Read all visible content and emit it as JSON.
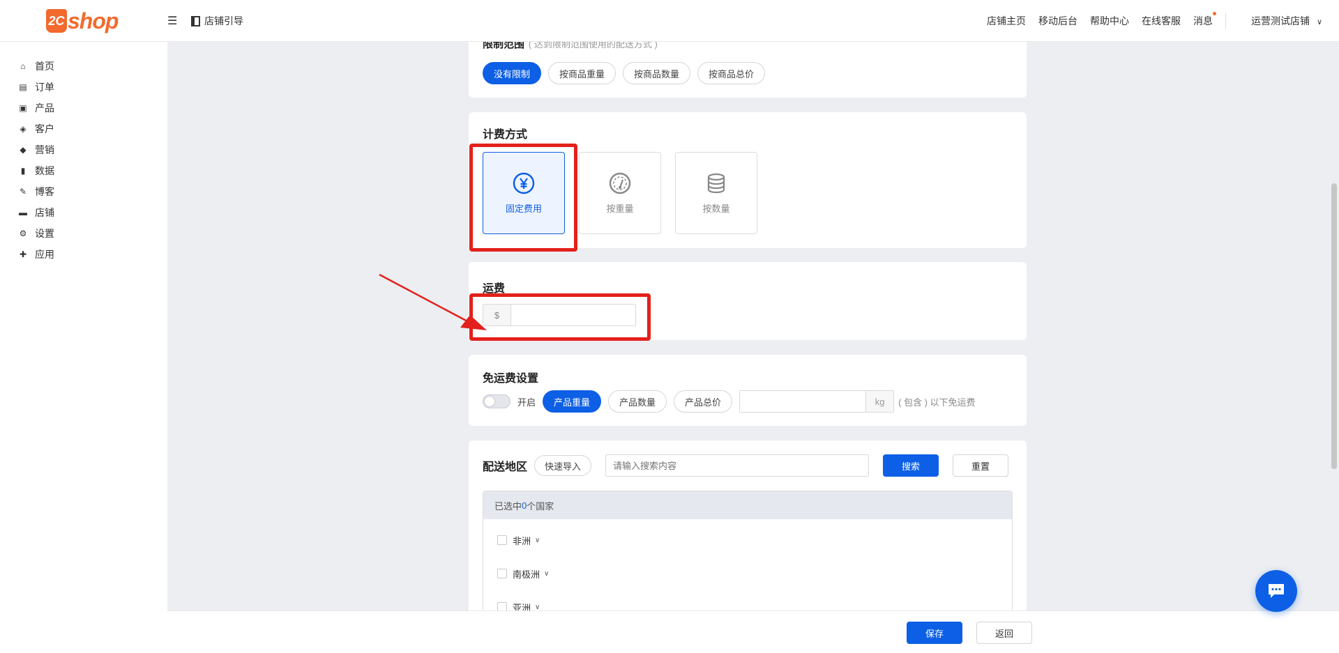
{
  "brand": {
    "logo_mark": "2C",
    "logo_text": "shop"
  },
  "header": {
    "menu_toggle_icon": "menu-icon",
    "guide_label": "店铺引导",
    "nav": [
      "店铺主页",
      "移动后台",
      "帮助中心",
      "在线客服",
      "消息"
    ],
    "store_name": "运营测试店铺"
  },
  "sidebar": {
    "items": [
      {
        "icon": "home-icon",
        "label": "首页"
      },
      {
        "icon": "order-icon",
        "label": "订单"
      },
      {
        "icon": "bag-icon",
        "label": "产品"
      },
      {
        "icon": "diamond-icon",
        "label": "客户"
      },
      {
        "icon": "tag-icon",
        "label": "营销"
      },
      {
        "icon": "bar-chart-icon",
        "label": "数据"
      },
      {
        "icon": "edit-icon",
        "label": "博客"
      },
      {
        "icon": "store-icon",
        "label": "店铺"
      },
      {
        "icon": "gear-icon",
        "label": "设置"
      },
      {
        "icon": "puzzle-icon",
        "label": "应用"
      }
    ]
  },
  "limit_scope": {
    "title": "限制范围",
    "hint": "( 达到限制范围使用的配送方式 )",
    "options": [
      "没有限制",
      "按商品重量",
      "按商品数量",
      "按商品总价"
    ],
    "selected": "没有限制"
  },
  "billing": {
    "title": "计费方式",
    "options": [
      {
        "icon": "yen-icon",
        "label": "固定费用"
      },
      {
        "icon": "gauge-icon",
        "label": "按重量"
      },
      {
        "icon": "database-icon",
        "label": "按数量"
      }
    ],
    "selected": "固定费用"
  },
  "freight": {
    "title": "运费",
    "currency": "$",
    "value": ""
  },
  "free_shipping": {
    "title": "免运费设置",
    "toggle_label": "开启",
    "toggle_on": false,
    "options": [
      "产品重量",
      "产品数量",
      "产品总价"
    ],
    "selected": "产品重量",
    "threshold_value": "",
    "unit": "kg",
    "suffix": "( 包含 ) 以下免运费"
  },
  "regions": {
    "title": "配送地区",
    "quick_import": "快速导入",
    "search_placeholder": "请输入搜索内容",
    "search_label": "搜索",
    "reset_label": "重置",
    "selected_prefix": "已选中",
    "selected_count": "0",
    "selected_suffix": "个国家",
    "items": [
      "非洲",
      "南极洲",
      "亚洲"
    ]
  },
  "footer": {
    "save_label": "保存",
    "back_label": "返回"
  },
  "colors": {
    "accent": "#0d5fe5",
    "brand": "#f26a2e",
    "highlight": "#e3201b"
  }
}
